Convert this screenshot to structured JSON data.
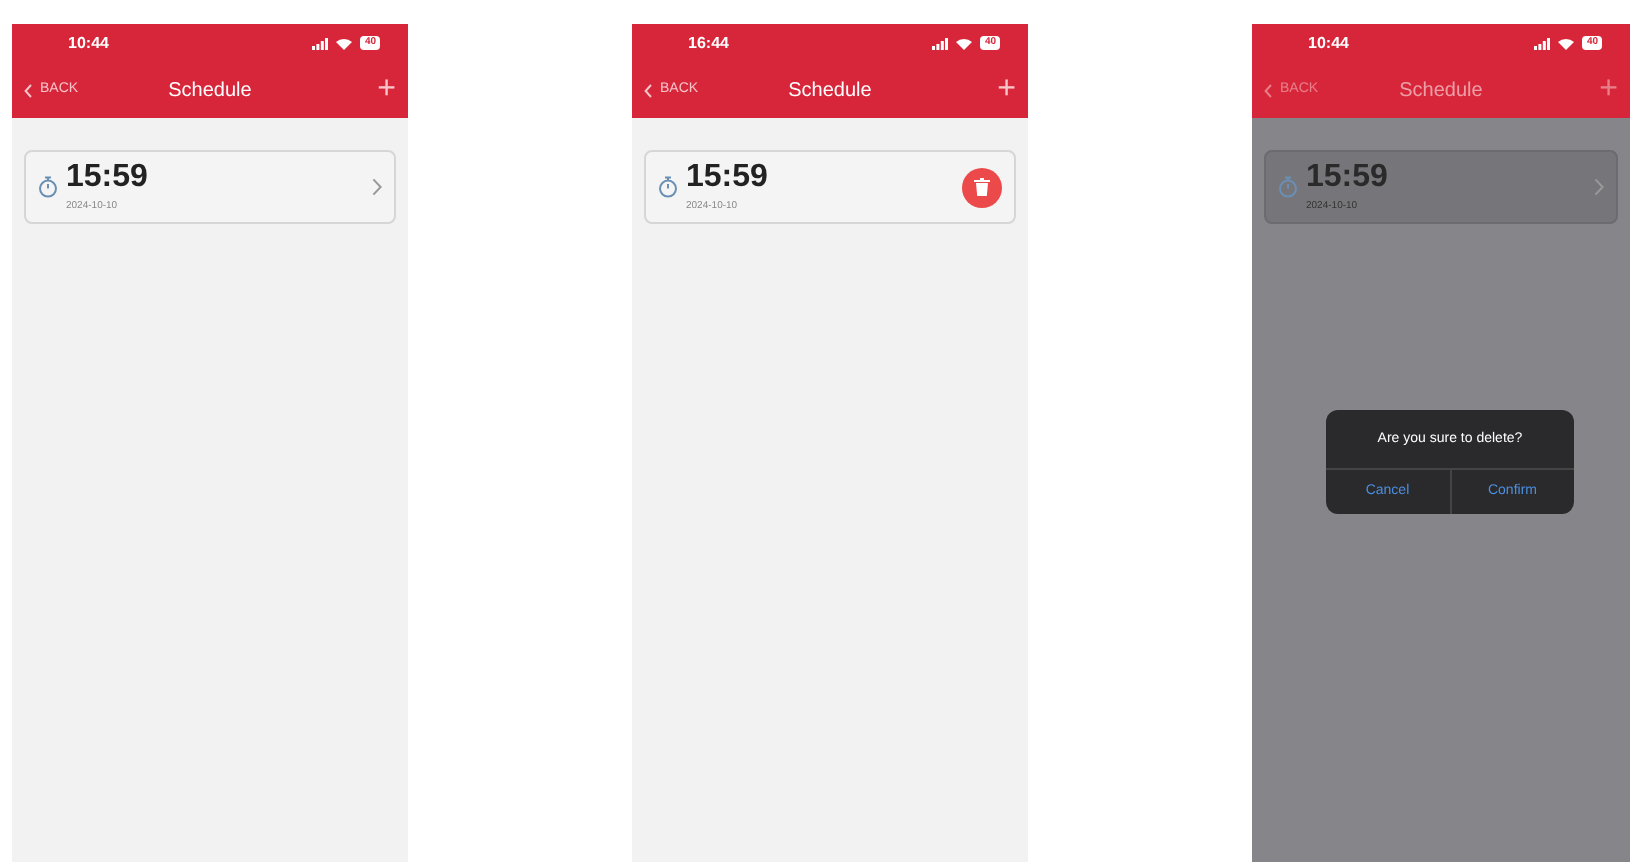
{
  "screens": [
    {
      "status_time": "10:44",
      "battery": "40",
      "nav": {
        "back": "BACK",
        "title": "Schedule",
        "add": "+"
      },
      "item": {
        "time": "15:59",
        "date": "2024-10-10",
        "swiped": false
      },
      "dimmed": false
    },
    {
      "status_time": "16:44",
      "battery": "40",
      "nav": {
        "back": "BACK",
        "title": "Schedule",
        "add": "+"
      },
      "item": {
        "time": "15:59",
        "date": "2024-10-10",
        "swiped": true
      },
      "dimmed": false
    },
    {
      "status_time": "10:44",
      "battery": "40",
      "nav": {
        "back": "BACK",
        "title": "Schedule",
        "add": "+"
      },
      "item": {
        "time": "15:59",
        "date": "2024-10-10",
        "swiped": false
      },
      "dimmed": true,
      "dialog": {
        "message": "Are you sure to delete?",
        "buttons": [
          "Cancel",
          "Confirm"
        ]
      }
    }
  ]
}
